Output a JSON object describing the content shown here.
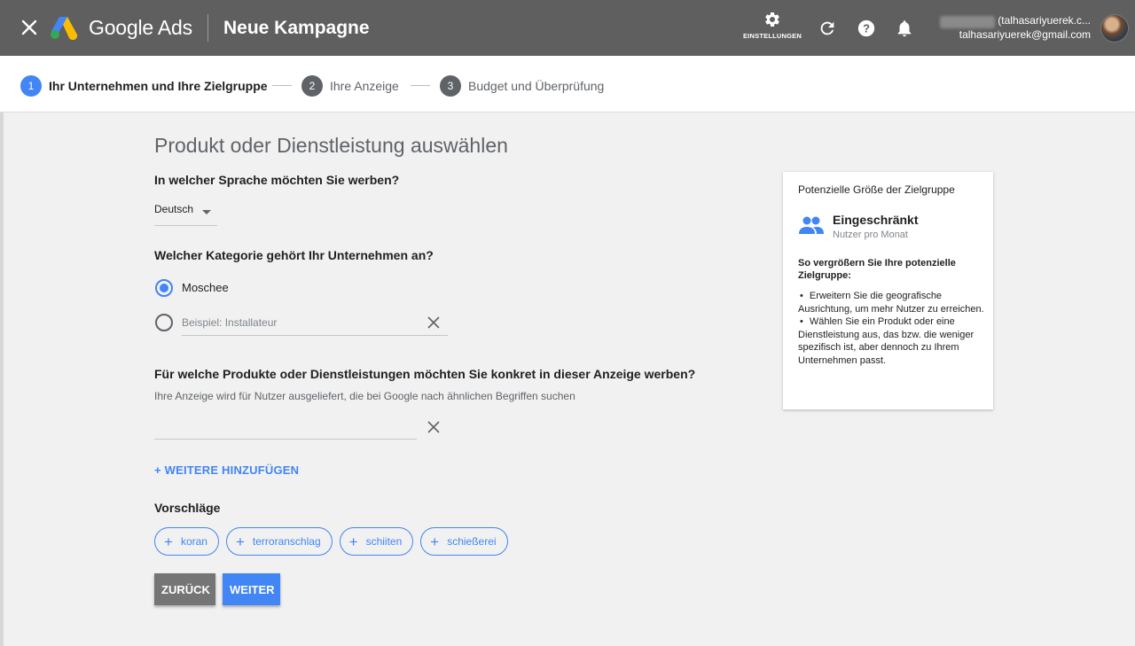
{
  "header": {
    "brand": "Google Ads",
    "title": "Neue Kampagne",
    "settings_label": "EINSTELLUNGEN",
    "account_phone": "265-205-6468",
    "account_name": "(talhasariyuerek.c...",
    "account_email": "talhasariyuerek@gmail.com"
  },
  "stepper": {
    "steps": [
      {
        "num": "1",
        "label": "Ihr Unternehmen und Ihre Zielgruppe"
      },
      {
        "num": "2",
        "label": "Ihre Anzeige"
      },
      {
        "num": "3",
        "label": "Budget und Überprüfung"
      }
    ]
  },
  "main": {
    "title": "Produkt oder Dienstleistung auswählen",
    "language_question": "In welcher Sprache möchten Sie werben?",
    "language_value": "Deutsch",
    "category_question": "Welcher Kategorie gehört Ihr Unternehmen an?",
    "category_selected": "Moschee",
    "category_other_placeholder": "Beispiel: Installateur",
    "products_question": "Für welche Produkte oder Dienstleistungen möchten Sie konkret in dieser Anzeige werben?",
    "products_hint": "Ihre Anzeige wird für Nutzer ausgeliefert, die bei Google nach ähnlichen Begriffen suchen",
    "product_value": "",
    "add_more": "+ WEITERE HINZUFÜGEN",
    "suggestions_title": "Vorschläge",
    "suggestions": [
      "koran",
      "terroranschlag",
      "schiiten",
      "schießerei"
    ],
    "back_label": "ZURÜCK",
    "next_label": "WEITER"
  },
  "audience": {
    "title": "Potenzielle Größe der Zielgruppe",
    "status": "Eingeschränkt",
    "status_sub": "Nutzer pro Monat",
    "howto": "So vergrößern Sie Ihre potenzielle Zielgruppe:",
    "tips": [
      "Erweitern Sie die geografische Ausrichtung, um mehr Nutzer zu erreichen.",
      "Wählen Sie ein Produkt oder eine Dienstleistung aus, das bzw. die weniger spezifisch ist, aber dennoch zu Ihrem Unternehmen passt."
    ]
  },
  "colors": {
    "topbar": "#5f5f5f",
    "accent": "#4285f4",
    "background": "#f1f1f1"
  },
  "icons": [
    "close-icon",
    "google-ads-logo",
    "gear-icon",
    "refresh-icon",
    "help-icon",
    "bell-icon",
    "people-icon",
    "clear-icon",
    "plus-icon",
    "chevron-down-icon"
  ]
}
